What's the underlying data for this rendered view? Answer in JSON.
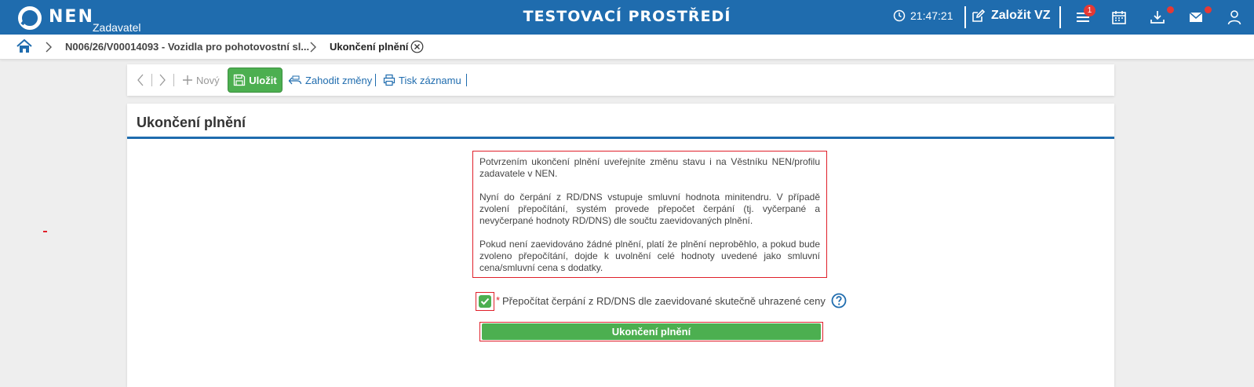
{
  "header": {
    "logo_text": "NEN",
    "logo_subtitle": "Zadavatel",
    "environment_title": "TESTOVACÍ PROSTŘEDÍ",
    "clock_time": "21:47:21",
    "create_label": "Založit VZ",
    "menu_badge_count": "1",
    "icons": [
      "clock-icon",
      "edit-icon",
      "menu-icon",
      "calendar-icon",
      "download-icon",
      "mail-icon",
      "user-icon"
    ],
    "colors": {
      "bar": "#1f6cae",
      "badge": "#e53935"
    }
  },
  "breadcrumb": {
    "items": [
      {
        "label": "N006/26/V00014093 - Vozidla pro pohotovostní sl..."
      },
      {
        "label": "Ukončení plnění"
      }
    ]
  },
  "toolbar": {
    "new_label": "Nový",
    "save_label": "Uložit",
    "discard_label": "Zahodit změny",
    "print_label": "Tisk záznamu"
  },
  "main": {
    "title": "Ukončení plnění",
    "info_paragraphs": [
      "Potvrzením ukončení plnění uveřejníte změnu stavu i na Věstníku NEN/profilu zadavatele v NEN.",
      "Nyní do čerpání z RD/DNS vstupuje smluvní hodnota minitendru. V případě zvolení přepočítání, systém provede přepočet čerpání (tj. vyčerpané a nevyčerpané hodnoty RD/DNS) dle součtu zaevidovaných plnění.",
      "Pokud není zaevidováno žádné plnění, platí že plnění neproběhlo, a pokud bude zvoleno přepočítání, dojde k uvolnění celé hodnoty uvedené jako smluvní cena/smluvní cena s dodatky."
    ],
    "recalc_checkbox": {
      "required_mark": "*",
      "label": "Přepočítat čerpání z RD/DNS dle zaevidované skutečně uhrazené ceny",
      "checked": true
    },
    "finish_button_label": "Ukončení plnění",
    "colors": {
      "accent": "#1f6cae",
      "success": "#4caf50",
      "highlight": "#e0202a"
    }
  }
}
